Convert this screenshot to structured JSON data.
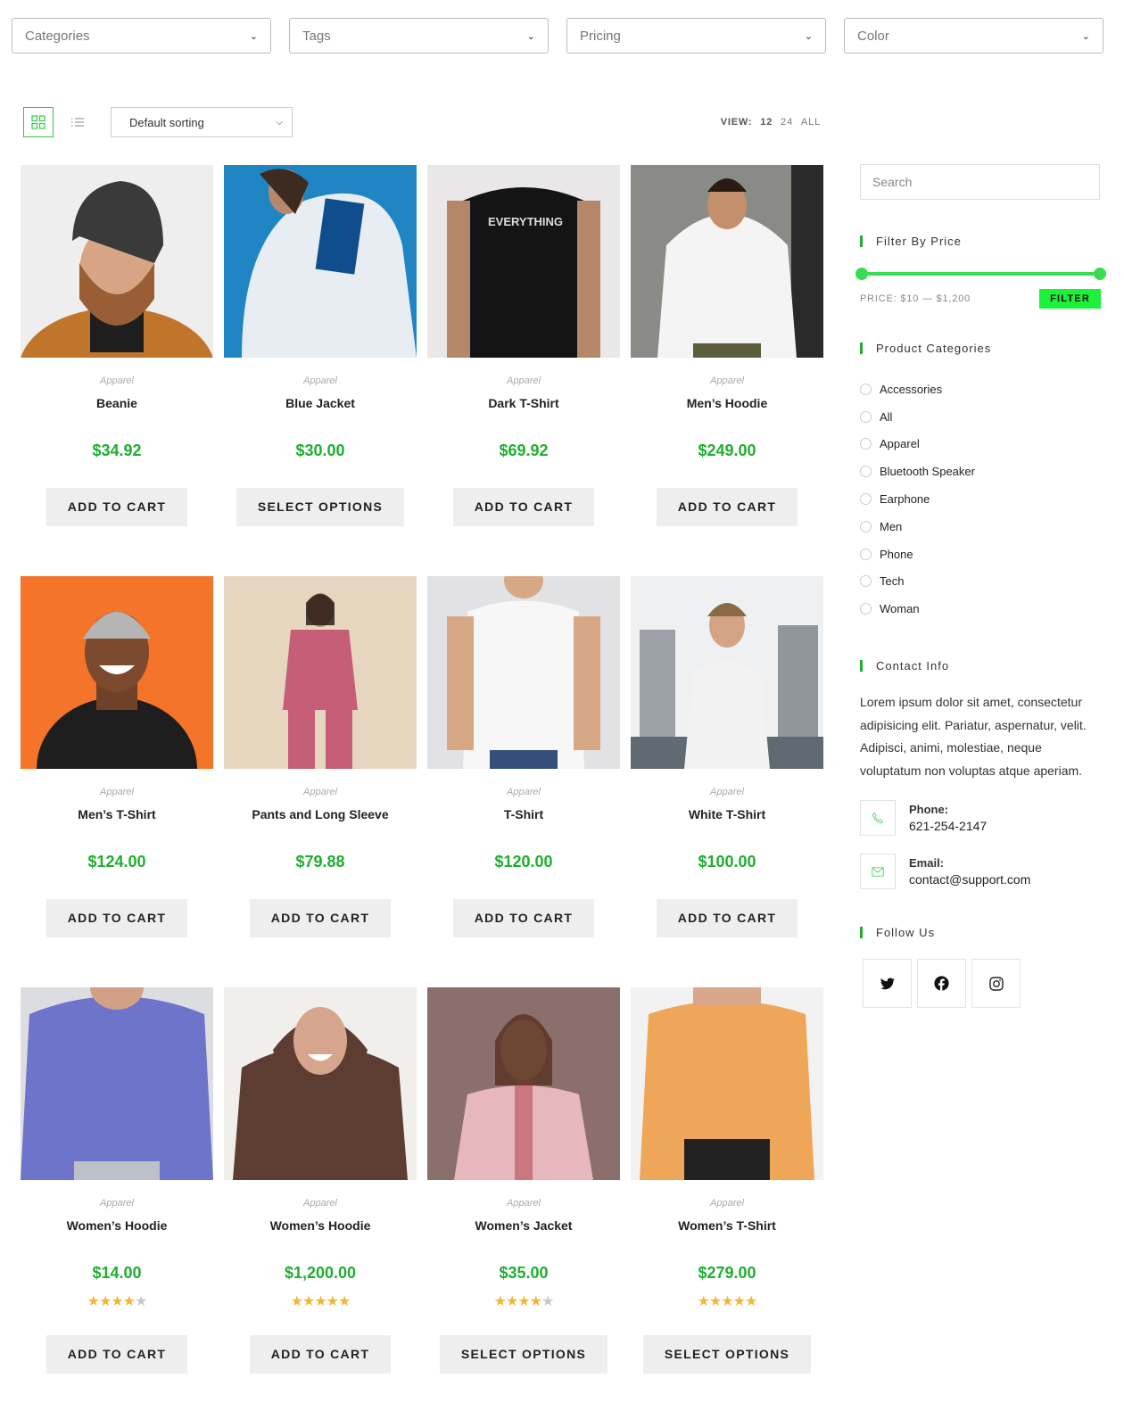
{
  "filters": {
    "categories": "Categories",
    "tags": "Tags",
    "pricing": "Pricing",
    "color": "Color"
  },
  "toolbar": {
    "sorting": "Default sorting",
    "view_label": "VIEW:",
    "view_options": [
      "12",
      "24",
      "ALL"
    ],
    "active_view": "12"
  },
  "products": [
    {
      "category": "Apparel",
      "name": "Beanie",
      "price": "$34.92",
      "button": "ADD TO CART",
      "rating": null,
      "image": "man-beanie-photo"
    },
    {
      "category": "Apparel",
      "name": "Blue Jacket",
      "price": "$30.00",
      "button": "SELECT OPTIONS",
      "rating": null,
      "image": "jacket-photo"
    },
    {
      "category": "Apparel",
      "name": "Dark T-Shirt",
      "price": "$69.92",
      "button": "ADD TO CART",
      "rating": null,
      "image": "dark-tshirt-photo",
      "print_text": "EVERYTHING"
    },
    {
      "category": "Apparel",
      "name": "Men’s Hoodie",
      "price": "$249.00",
      "button": "ADD TO CART",
      "rating": null,
      "image": "white-hoodie-photo"
    },
    {
      "category": "Apparel",
      "name": "Men’s T-Shirt",
      "price": "$124.00",
      "button": "ADD TO CART",
      "rating": null,
      "image": "polo-photo"
    },
    {
      "category": "Apparel",
      "name": "Pants and Long Sleeve",
      "price": "$79.88",
      "button": "ADD TO CART",
      "rating": null,
      "image": "pink-set-photo"
    },
    {
      "category": "Apparel",
      "name": "T-Shirt",
      "price": "$120.00",
      "button": "ADD TO CART",
      "rating": null,
      "image": "white-tshirt-photo"
    },
    {
      "category": "Apparel",
      "name": "White T-Shirt",
      "price": "$100.00",
      "button": "ADD TO CART",
      "rating": null,
      "image": "city-woman-photo"
    },
    {
      "category": "Apparel",
      "name": "Women’s Hoodie",
      "price": "$14.00",
      "button": "ADD TO CART",
      "rating": 4,
      "image": "purple-hoodie-photo"
    },
    {
      "category": "Apparel",
      "name": "Women’s Hoodie",
      "price": "$1,200.00",
      "button": "ADD TO CART",
      "rating": 5,
      "image": "brown-hoodie-photo"
    },
    {
      "category": "Apparel",
      "name": "Women’s Jacket",
      "price": "$35.00",
      "button": "SELECT OPTIONS",
      "rating": 4,
      "image": "pink-jacket-photo"
    },
    {
      "category": "Apparel",
      "name": "Women’s T-Shirt",
      "price": "$279.00",
      "button": "SELECT OPTIONS",
      "rating": 4.5,
      "image": "orange-tshirt-photo"
    }
  ],
  "sidebar": {
    "search_placeholder": "Search",
    "filter_title": "Filter By Price",
    "price_text": "PRICE: $10 — $1,200",
    "filter_button": "FILTER",
    "price_range": {
      "min": 10,
      "max": 1200
    },
    "categories_title": "Product Categories",
    "categories": [
      "Accessories",
      "All",
      "Apparel",
      "Bluetooth Speaker",
      "Earphone",
      "Men",
      "Phone",
      "Tech",
      "Woman"
    ],
    "contact_title": "Contact Info",
    "contact_text": "Lorem ipsum dolor sit amet, consectetur adipisicing elit. Pariatur, aspernatur, velit. Adipisci, animi, molestiae, neque voluptatum non voluptas atque aperiam.",
    "phone_label": "Phone:",
    "phone": "621-254-2147",
    "email_label": "Email:",
    "email": "contact@support.com",
    "follow_title": "Follow Us",
    "social": [
      "twitter-icon",
      "facebook-icon",
      "instagram-icon"
    ]
  },
  "colors": {
    "accent": "#1fae2f",
    "filter_button": "#1cf03b",
    "slider": "#3bdc53",
    "star": "#f2b53c"
  }
}
